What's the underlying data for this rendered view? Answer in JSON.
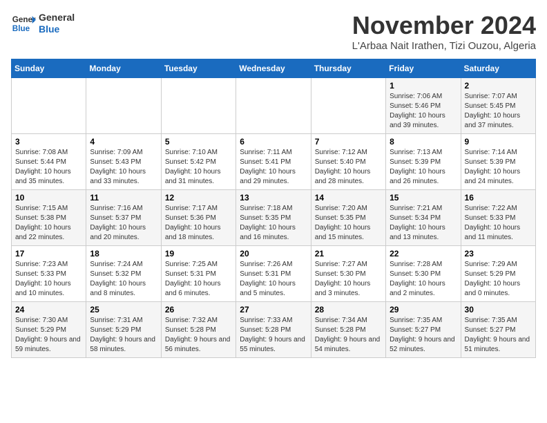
{
  "logo": {
    "line1": "General",
    "line2": "Blue"
  },
  "title": "November 2024",
  "location": "L'Arbaa Nait Irathen, Tizi Ouzou, Algeria",
  "weekdays": [
    "Sunday",
    "Monday",
    "Tuesday",
    "Wednesday",
    "Thursday",
    "Friday",
    "Saturday"
  ],
  "weeks": [
    [
      {
        "day": "",
        "info": ""
      },
      {
        "day": "",
        "info": ""
      },
      {
        "day": "",
        "info": ""
      },
      {
        "day": "",
        "info": ""
      },
      {
        "day": "",
        "info": ""
      },
      {
        "day": "1",
        "info": "Sunrise: 7:06 AM\nSunset: 5:46 PM\nDaylight: 10 hours and 39 minutes."
      },
      {
        "day": "2",
        "info": "Sunrise: 7:07 AM\nSunset: 5:45 PM\nDaylight: 10 hours and 37 minutes."
      }
    ],
    [
      {
        "day": "3",
        "info": "Sunrise: 7:08 AM\nSunset: 5:44 PM\nDaylight: 10 hours and 35 minutes."
      },
      {
        "day": "4",
        "info": "Sunrise: 7:09 AM\nSunset: 5:43 PM\nDaylight: 10 hours and 33 minutes."
      },
      {
        "day": "5",
        "info": "Sunrise: 7:10 AM\nSunset: 5:42 PM\nDaylight: 10 hours and 31 minutes."
      },
      {
        "day": "6",
        "info": "Sunrise: 7:11 AM\nSunset: 5:41 PM\nDaylight: 10 hours and 29 minutes."
      },
      {
        "day": "7",
        "info": "Sunrise: 7:12 AM\nSunset: 5:40 PM\nDaylight: 10 hours and 28 minutes."
      },
      {
        "day": "8",
        "info": "Sunrise: 7:13 AM\nSunset: 5:39 PM\nDaylight: 10 hours and 26 minutes."
      },
      {
        "day": "9",
        "info": "Sunrise: 7:14 AM\nSunset: 5:39 PM\nDaylight: 10 hours and 24 minutes."
      }
    ],
    [
      {
        "day": "10",
        "info": "Sunrise: 7:15 AM\nSunset: 5:38 PM\nDaylight: 10 hours and 22 minutes."
      },
      {
        "day": "11",
        "info": "Sunrise: 7:16 AM\nSunset: 5:37 PM\nDaylight: 10 hours and 20 minutes."
      },
      {
        "day": "12",
        "info": "Sunrise: 7:17 AM\nSunset: 5:36 PM\nDaylight: 10 hours and 18 minutes."
      },
      {
        "day": "13",
        "info": "Sunrise: 7:18 AM\nSunset: 5:35 PM\nDaylight: 10 hours and 16 minutes."
      },
      {
        "day": "14",
        "info": "Sunrise: 7:20 AM\nSunset: 5:35 PM\nDaylight: 10 hours and 15 minutes."
      },
      {
        "day": "15",
        "info": "Sunrise: 7:21 AM\nSunset: 5:34 PM\nDaylight: 10 hours and 13 minutes."
      },
      {
        "day": "16",
        "info": "Sunrise: 7:22 AM\nSunset: 5:33 PM\nDaylight: 10 hours and 11 minutes."
      }
    ],
    [
      {
        "day": "17",
        "info": "Sunrise: 7:23 AM\nSunset: 5:33 PM\nDaylight: 10 hours and 10 minutes."
      },
      {
        "day": "18",
        "info": "Sunrise: 7:24 AM\nSunset: 5:32 PM\nDaylight: 10 hours and 8 minutes."
      },
      {
        "day": "19",
        "info": "Sunrise: 7:25 AM\nSunset: 5:31 PM\nDaylight: 10 hours and 6 minutes."
      },
      {
        "day": "20",
        "info": "Sunrise: 7:26 AM\nSunset: 5:31 PM\nDaylight: 10 hours and 5 minutes."
      },
      {
        "day": "21",
        "info": "Sunrise: 7:27 AM\nSunset: 5:30 PM\nDaylight: 10 hours and 3 minutes."
      },
      {
        "day": "22",
        "info": "Sunrise: 7:28 AM\nSunset: 5:30 PM\nDaylight: 10 hours and 2 minutes."
      },
      {
        "day": "23",
        "info": "Sunrise: 7:29 AM\nSunset: 5:29 PM\nDaylight: 10 hours and 0 minutes."
      }
    ],
    [
      {
        "day": "24",
        "info": "Sunrise: 7:30 AM\nSunset: 5:29 PM\nDaylight: 9 hours and 59 minutes."
      },
      {
        "day": "25",
        "info": "Sunrise: 7:31 AM\nSunset: 5:29 PM\nDaylight: 9 hours and 58 minutes."
      },
      {
        "day": "26",
        "info": "Sunrise: 7:32 AM\nSunset: 5:28 PM\nDaylight: 9 hours and 56 minutes."
      },
      {
        "day": "27",
        "info": "Sunrise: 7:33 AM\nSunset: 5:28 PM\nDaylight: 9 hours and 55 minutes."
      },
      {
        "day": "28",
        "info": "Sunrise: 7:34 AM\nSunset: 5:28 PM\nDaylight: 9 hours and 54 minutes."
      },
      {
        "day": "29",
        "info": "Sunrise: 7:35 AM\nSunset: 5:27 PM\nDaylight: 9 hours and 52 minutes."
      },
      {
        "day": "30",
        "info": "Sunrise: 7:35 AM\nSunset: 5:27 PM\nDaylight: 9 hours and 51 minutes."
      }
    ]
  ]
}
